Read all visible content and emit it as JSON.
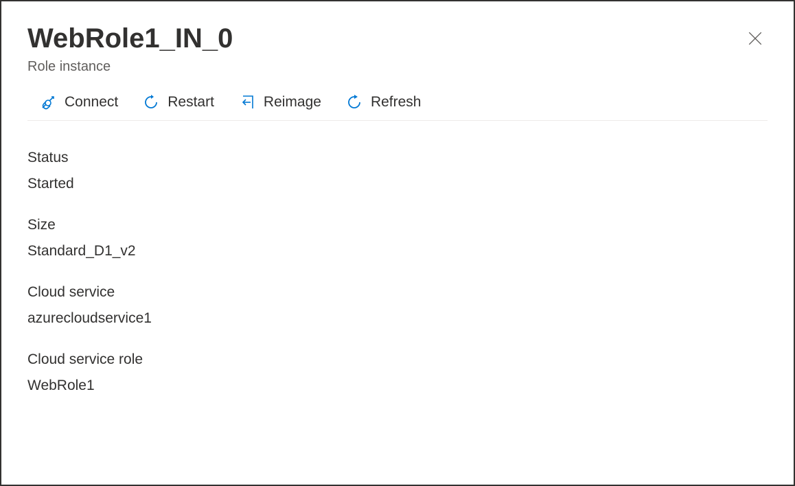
{
  "header": {
    "title": "WebRole1_IN_0",
    "subtitle": "Role instance"
  },
  "toolbar": {
    "connect_label": "Connect",
    "restart_label": "Restart",
    "reimage_label": "Reimage",
    "refresh_label": "Refresh"
  },
  "properties": {
    "status": {
      "label": "Status",
      "value": "Started"
    },
    "size": {
      "label": "Size",
      "value": "Standard_D1_v2"
    },
    "cloud_service": {
      "label": "Cloud service",
      "value": "azurecloudservice1"
    },
    "cloud_service_role": {
      "label": "Cloud service role",
      "value": "WebRole1"
    }
  }
}
